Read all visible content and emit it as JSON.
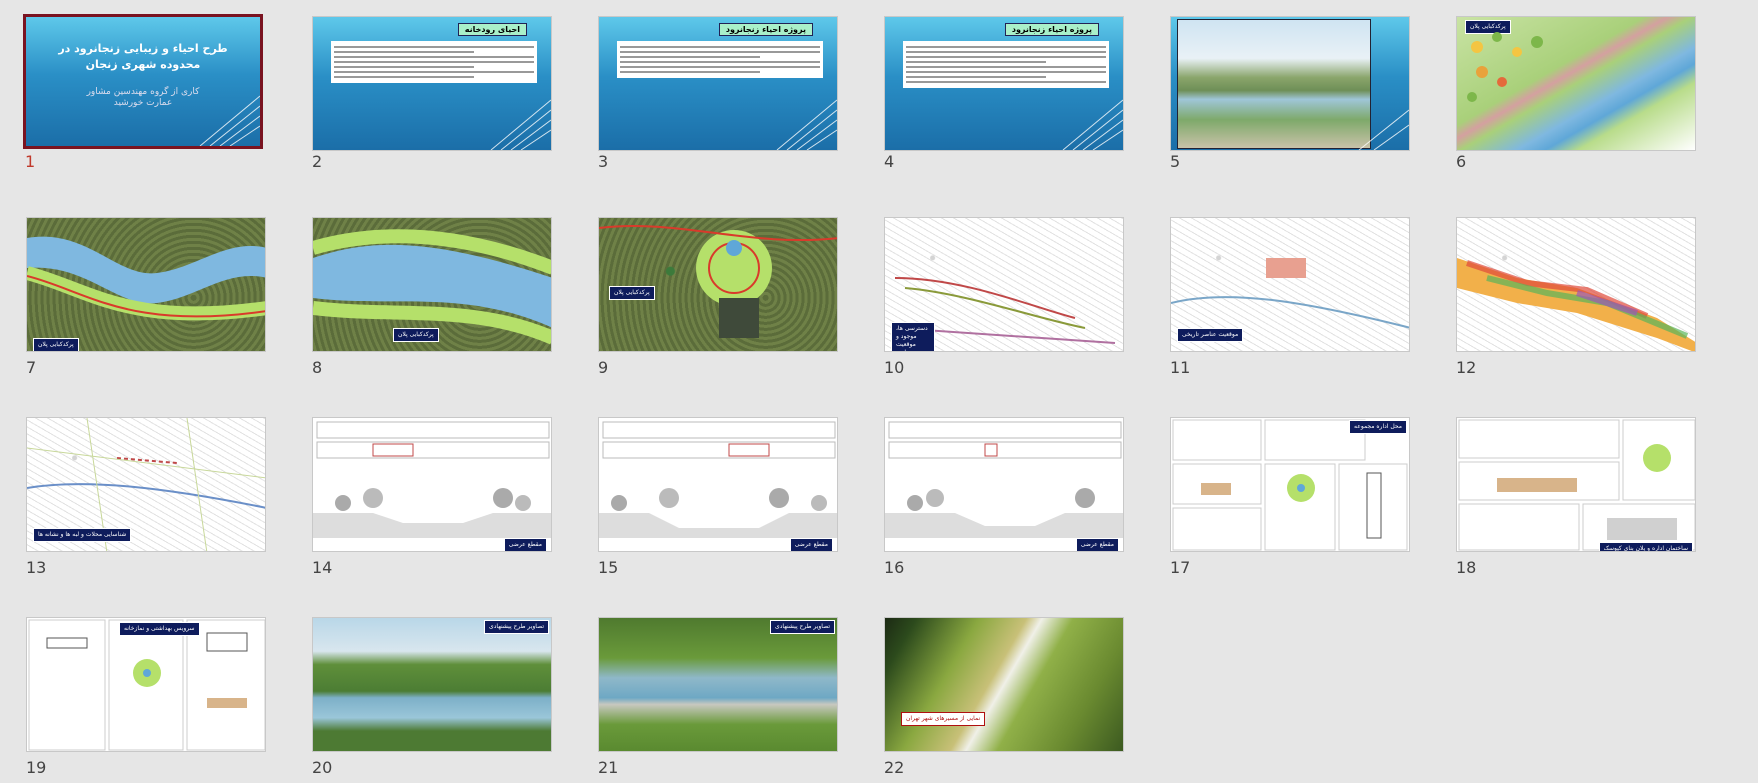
{
  "slides": [
    {
      "number": "1",
      "title": "طرح احیاء و زیبایی زنجانرود در محدوده شهری زنجان",
      "subtitle": "کاری از گروه مهندسین مشاور عمارت خورشید"
    },
    {
      "number": "2",
      "header": "احیای رودخانه"
    },
    {
      "number": "3",
      "header": "پروژه احیاء زنجانرود"
    },
    {
      "number": "4",
      "header": "پروژه احیاء زنجانرود"
    },
    {
      "number": "5"
    },
    {
      "number": "6",
      "label": "پرکدکبایی پلان"
    },
    {
      "number": "7",
      "label": "پرکدکبایی پلان"
    },
    {
      "number": "8",
      "label": "پرکدکبایی پلان"
    },
    {
      "number": "9",
      "label": "پرکدکبایی پلان"
    },
    {
      "number": "10",
      "label": "دسترسی ها، موجود و موقعیت عناصر تاریخی"
    },
    {
      "number": "11",
      "label": "موقعیت عناصر تاریخی"
    },
    {
      "number": "12"
    },
    {
      "number": "13",
      "label": "شناسایی محلات و لبه ها و نشانه ها"
    },
    {
      "number": "14",
      "label": "مقطع عرضی"
    },
    {
      "number": "15",
      "label": "مقطع عرضی"
    },
    {
      "number": "16",
      "label": "مقطع عرضی"
    },
    {
      "number": "17",
      "label": "محل اداره مجموعه"
    },
    {
      "number": "18",
      "label": "ساختمان اداره و پلان بنای کیوسک"
    },
    {
      "number": "19",
      "label": "سرویس بهداشتی و نمازخانه"
    },
    {
      "number": "20",
      "label": "تصاویر طرح پیشنهادی"
    },
    {
      "number": "21",
      "label": "تصاویر طرح پیشنهادی"
    },
    {
      "number": "22",
      "label": "نمایی از مسیرهای شهر تهران"
    }
  ],
  "colors": {
    "selected_border": "#7a1320",
    "selected_number": "#c0392b",
    "label_bg": "#0e1c5c",
    "header_bg": "#a9f0c9",
    "background": "#e6e6e6"
  }
}
